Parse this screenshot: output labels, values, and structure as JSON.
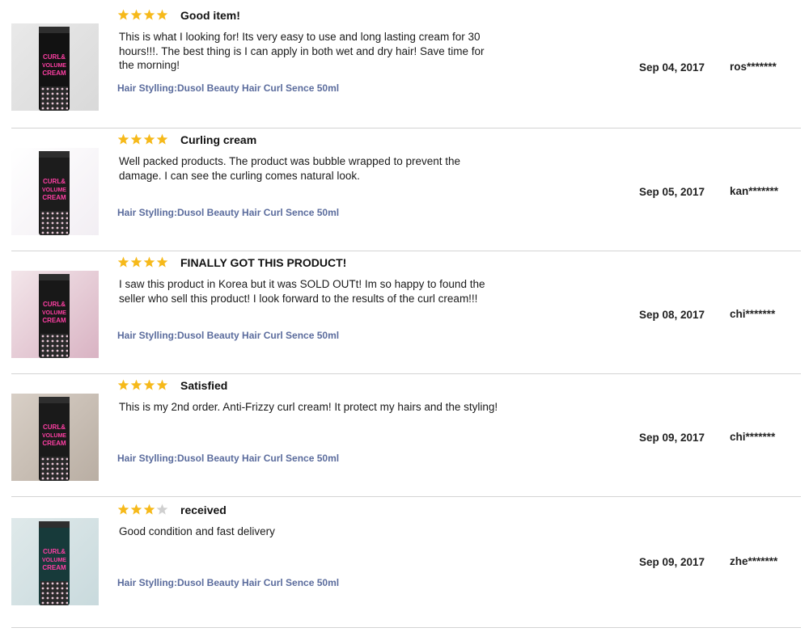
{
  "colors": {
    "star_filled": "#f6b91a",
    "star_empty": "#cfcfcf",
    "product_link": "#5b6c9d",
    "divider": "#d4d4d4"
  },
  "reviews": [
    {
      "rating": 4,
      "title": "Good item!",
      "body": "This is what I looking for! Its very easy to use and long lasting cream for 30 hours!!!. The best thing is I can apply in both wet and dry hair! Save time for the morning!",
      "product": "Hair Stylling:Dusol Beauty Hair Curl Sence 50ml",
      "date": "Sep 04, 2017",
      "user": "ros*******",
      "thumb_text": "CURL& VOLUME CREAM"
    },
    {
      "rating": 4,
      "title": "Curling cream",
      "body": "Well packed products. The product was bubble wrapped to prevent the damage. I can see the curling comes natural look.",
      "product": "Hair Stylling:Dusol Beauty Hair Curl Sence 50ml",
      "date": "Sep 05, 2017",
      "user": "kan*******",
      "thumb_text": "CURL& VOLUME CREAM"
    },
    {
      "rating": 4,
      "title": "FINALLY GOT THIS PRODUCT!",
      "body": "I saw this product in Korea but it was SOLD OUTt! Im so happy to found the seller who sell this product! I look forward to the results of the curl cream!!!",
      "product": "Hair Stylling:Dusol Beauty Hair Curl Sence 50ml",
      "date": "Sep 08, 2017",
      "user": "chi*******",
      "thumb_text": "CURL& VOLUME CREAM"
    },
    {
      "rating": 4,
      "title": "Satisfied",
      "body": "This is my 2nd order. Anti-Frizzy curl cream! It protect my hairs and the styling!",
      "product": "Hair Stylling:Dusol Beauty Hair Curl Sence 50ml",
      "date": "Sep 09, 2017",
      "user": "chi*******",
      "thumb_text": "CURL& VOLUME CREAM"
    },
    {
      "rating": 3,
      "title": "received",
      "body": "Good condition and fast delivery",
      "product": "Hair Stylling:Dusol Beauty Hair Curl Sence 50ml",
      "date": "Sep 09, 2017",
      "user": "zhe*******",
      "thumb_text": "CURL& VOLUME CREAM"
    }
  ]
}
